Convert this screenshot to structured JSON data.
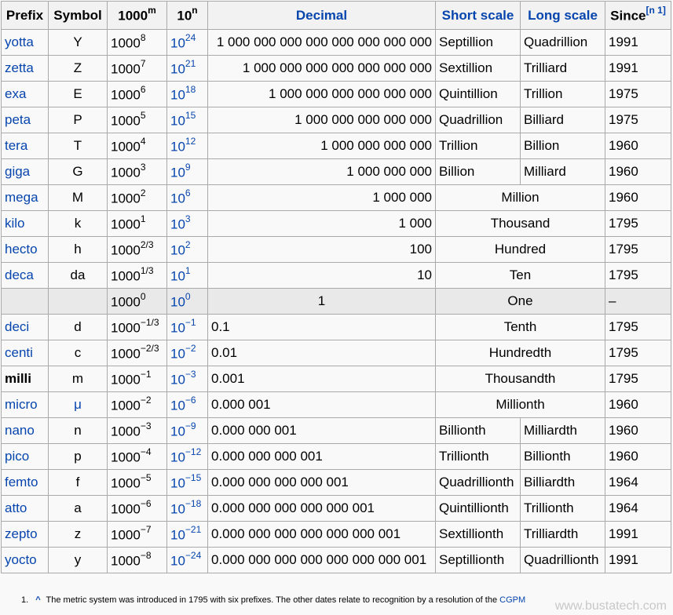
{
  "headers": {
    "prefix": "Prefix",
    "symbol": "Symbol",
    "thousand_base": "1000",
    "thousand_exp": "m",
    "ten_base": "10",
    "ten_exp": "n",
    "decimal": "Decimal",
    "short_scale": "Short scale",
    "long_scale": "Long scale",
    "since": "Since",
    "since_note": "[n 1]"
  },
  "rows": [
    {
      "prefix": "yotta",
      "symbol": "Y",
      "tm": "8",
      "tn": "24",
      "decimal": "1 000 000 000 000 000 000 000 000",
      "short": "Septillion",
      "long": "Quadrillion",
      "since": "1991"
    },
    {
      "prefix": "zetta",
      "symbol": "Z",
      "tm": "7",
      "tn": "21",
      "decimal": "1 000 000 000 000 000 000 000",
      "short": "Sextillion",
      "long": "Trilliard",
      "since": "1991"
    },
    {
      "prefix": "exa",
      "symbol": "E",
      "tm": "6",
      "tn": "18",
      "decimal": "1 000 000 000 000 000 000",
      "short": "Quintillion",
      "long": "Trillion",
      "since": "1975"
    },
    {
      "prefix": "peta",
      "symbol": "P",
      "tm": "5",
      "tn": "15",
      "decimal": "1 000 000 000 000 000",
      "short": "Quadrillion",
      "long": "Billiard",
      "since": "1975"
    },
    {
      "prefix": "tera",
      "symbol": "T",
      "tm": "4",
      "tn": "12",
      "decimal": "1 000 000 000 000",
      "short": "Trillion",
      "long": "Billion",
      "since": "1960"
    },
    {
      "prefix": "giga",
      "symbol": "G",
      "tm": "3",
      "tn": "9",
      "decimal": "1 000 000 000",
      "short": "Billion",
      "long": "Milliard",
      "since": "1960"
    },
    {
      "prefix": "mega",
      "symbol": "M",
      "tm": "2",
      "tn": "6",
      "decimal": "1 000 000",
      "scale": "Million",
      "since": "1960"
    },
    {
      "prefix": "kilo",
      "symbol": "k",
      "tm": "1",
      "tn": "3",
      "decimal": "1 000",
      "scale": "Thousand",
      "since": "1795"
    },
    {
      "prefix": "hecto",
      "symbol": "h",
      "tm": "2/3",
      "tn": "2",
      "decimal": "100",
      "scale": "Hundred",
      "since": "1795"
    },
    {
      "prefix": "deca",
      "symbol": "da",
      "tm": "1/3",
      "tn": "1",
      "decimal": "10",
      "scale": "Ten",
      "since": "1795"
    },
    {
      "prefix": "",
      "symbol": "",
      "tm": "0",
      "tn": "0",
      "decimal": "1",
      "scale": "One",
      "since": "–",
      "shade": true
    },
    {
      "prefix": "deci",
      "symbol": "d",
      "tm": "−1/3",
      "tn": "−1",
      "decimal": "0.1",
      "scale": "Tenth",
      "since": "1795"
    },
    {
      "prefix": "centi",
      "symbol": "c",
      "tm": "−2/3",
      "tn": "−2",
      "decimal": "0.01",
      "scale": "Hundredth",
      "since": "1795"
    },
    {
      "prefix": "milli",
      "symbol": "m",
      "tm": "−1",
      "tn": "−3",
      "decimal": "0.001",
      "scale": "Thousandth",
      "since": "1795",
      "bold": true
    },
    {
      "prefix": "micro",
      "symbol": "μ",
      "tm": "−2",
      "tn": "−6",
      "decimal": "0.000 001",
      "scale": "Millionth",
      "since": "1960",
      "symbol_link": true
    },
    {
      "prefix": "nano",
      "symbol": "n",
      "tm": "−3",
      "tn": "−9",
      "decimal": "0.000 000 001",
      "short": "Billionth",
      "long": "Milliardth",
      "since": "1960"
    },
    {
      "prefix": "pico",
      "symbol": "p",
      "tm": "−4",
      "tn": "−12",
      "decimal": "0.000 000 000 001",
      "short": "Trillionth",
      "long": "Billionth",
      "since": "1960"
    },
    {
      "prefix": "femto",
      "symbol": "f",
      "tm": "−5",
      "tn": "−15",
      "decimal": "0.000 000 000 000 001",
      "short": "Quadrillionth",
      "long": "Billiardth",
      "since": "1964"
    },
    {
      "prefix": "atto",
      "symbol": "a",
      "tm": "−6",
      "tn": "−18",
      "decimal": "0.000 000 000 000 000 001",
      "short": "Quintillionth",
      "long": "Trillionth",
      "since": "1964"
    },
    {
      "prefix": "zepto",
      "symbol": "z",
      "tm": "−7",
      "tn": "−21",
      "decimal": "0.000 000 000 000 000 000 001",
      "short": "Sextillionth",
      "long": "Trilliardth",
      "since": "1991"
    },
    {
      "prefix": "yocto",
      "symbol": "y",
      "tm": "−8",
      "tn": "−24",
      "decimal": "0.000 000 000 000 000 000 000 001",
      "short": "Septillionth",
      "long": "Quadrillionth",
      "since": "1991"
    }
  ],
  "footnote": {
    "number": "1.",
    "caret": "^",
    "text": "The metric system was introduced in 1795 with six prefixes. The other dates relate to recognition by a resolution of the",
    "link": "CGPM"
  },
  "watermark": "www.bustatech.com",
  "colors": {
    "link": "#0645ad",
    "border": "#aaaaaa",
    "header_bg": "#f2f2f2",
    "body_bg": "#f9f9f9",
    "shade_bg": "#e9e9e9"
  }
}
